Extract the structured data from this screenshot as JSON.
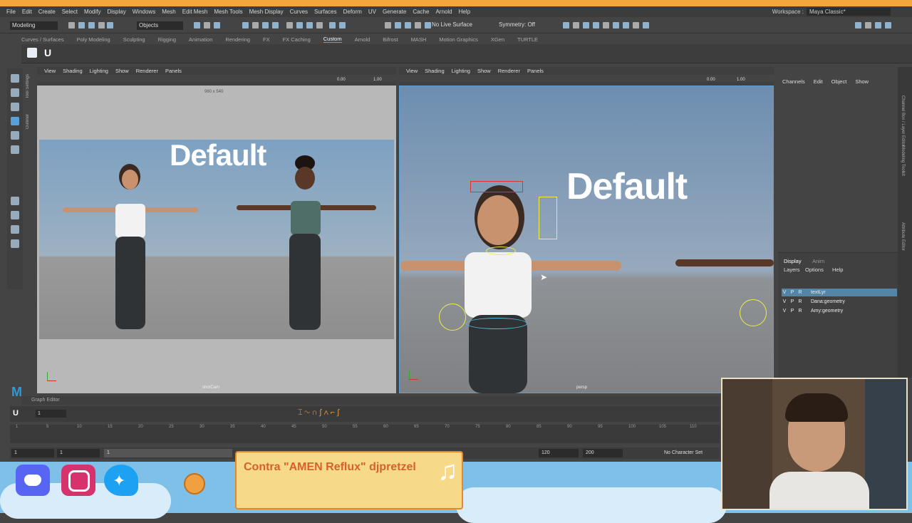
{
  "menu": [
    "File",
    "Edit",
    "Create",
    "Select",
    "Modify",
    "Display",
    "Windows",
    "Mesh",
    "Edit Mesh",
    "Mesh Tools",
    "Mesh Display",
    "Curves",
    "Surfaces",
    "Deform",
    "UV",
    "Generate",
    "Cache",
    "Arnold",
    "Help"
  ],
  "workspace": {
    "label": "Workspace :",
    "value": "Maya Classic*"
  },
  "status": {
    "mode": "Modeling",
    "selection_mask": "Objects",
    "live_surface": "No Live Surface",
    "symmetry": "Symmetry: Off"
  },
  "shelf_tabs": [
    "Curves / Surfaces",
    "Poly Modeling",
    "Sculpting",
    "Rigging",
    "Animation",
    "Rendering",
    "FX",
    "FX Caching",
    "Custom",
    "Arnold",
    "Bifrost",
    "MASH",
    "Motion Graphics",
    "XGen",
    "TURTLE"
  ],
  "shelf_active": "Custom",
  "viewport_menu": [
    "View",
    "Shading",
    "Lighting",
    "Show",
    "Renderer",
    "Panels"
  ],
  "viewport_left": {
    "resolution": "960 x 540",
    "camera": "shotCam",
    "overlay_text": "Default",
    "val1": "0.00",
    "val2": "1.00"
  },
  "viewport_right": {
    "camera": "persp",
    "overlay_text": "Default",
    "val1": "0.00",
    "val2": "1.00"
  },
  "channel_box": {
    "tabs": [
      "Channels",
      "Edit",
      "Object",
      "Show"
    ]
  },
  "layer_editor": {
    "tabs": [
      "Display",
      "Anim"
    ],
    "menu": [
      "Layers",
      "Options",
      "Help"
    ],
    "layers": [
      {
        "name": "textLyr",
        "selected": true
      },
      {
        "name": "Dana:geometry",
        "selected": false
      },
      {
        "name": "Amy:geometry",
        "selected": false
      }
    ],
    "vpr": [
      "V",
      "P",
      "R"
    ]
  },
  "side_tabs": [
    "Channel Box / Layer Editor",
    "Modeling Toolkit",
    "Attribute Editor"
  ],
  "left_tabs": [
    "Tool Settings",
    "Outliner"
  ],
  "graph_editor": {
    "label": "Graph Editor",
    "frame_field": "1"
  },
  "timeline": {
    "ticks": [
      "1",
      "5",
      "10",
      "15",
      "20",
      "25",
      "30",
      "35",
      "40",
      "45",
      "50",
      "55",
      "60",
      "65",
      "70",
      "75",
      "80",
      "85",
      "90",
      "95",
      "100",
      "105",
      "110"
    ]
  },
  "range": {
    "start": "1",
    "anim_start": "1",
    "playback_start": "1",
    "playback_end": "120",
    "anim_end": "200",
    "character_set": "No Character Set"
  },
  "overlay": {
    "now_playing": "Contra \"AMEN Reflux\" djpretzel"
  },
  "colors": {
    "accent": "#5aa0d8",
    "banner": "#f3a63a",
    "sky": "#7ec0e8",
    "now_playing_bg": "#f7d98a",
    "now_playing_text": "#d6612a",
    "discord": "#5865f2",
    "instagram": "#d6336c",
    "twitter": "#1da1f2"
  },
  "icons": [
    "discord-icon",
    "instagram-icon",
    "twitter-icon",
    "music-note-icon",
    "select-tool-icon",
    "lasso-tool-icon",
    "paint-tool-icon",
    "move-tool-icon",
    "play-icon"
  ]
}
